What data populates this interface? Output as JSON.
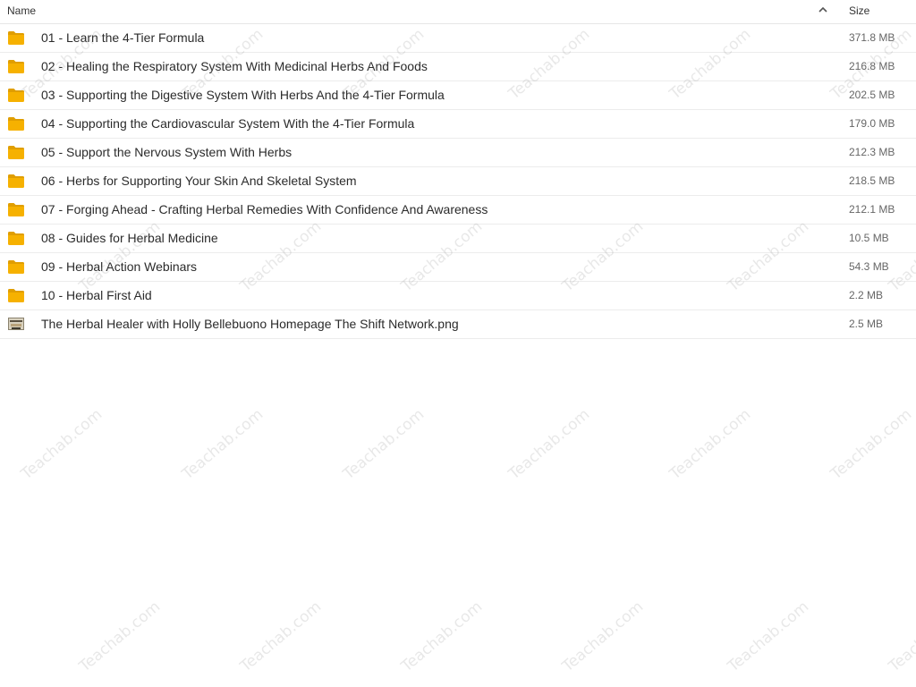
{
  "header": {
    "name_label": "Name",
    "size_label": "Size",
    "sort_icon": "chevron-up-icon"
  },
  "rows": [
    {
      "name": "01 - Learn the 4-Tier Formula",
      "size": "371.8 MB",
      "type": "folder"
    },
    {
      "name": "02 - Healing the Respiratory System With Medicinal Herbs And Foods",
      "size": "216.8 MB",
      "type": "folder"
    },
    {
      "name": "03 - Supporting the Digestive System With Herbs And the 4-Tier Formula",
      "size": "202.5 MB",
      "type": "folder"
    },
    {
      "name": "04 - Supporting the Cardiovascular System With the 4-Tier Formula",
      "size": "179.0 MB",
      "type": "folder"
    },
    {
      "name": "05 - Support the Nervous System With Herbs",
      "size": "212.3 MB",
      "type": "folder"
    },
    {
      "name": "06 - Herbs for Supporting Your Skin And Skeletal System",
      "size": "218.5 MB",
      "type": "folder"
    },
    {
      "name": "07 - Forging Ahead - Crafting Herbal Remedies With Confidence And Awareness",
      "size": "212.1 MB",
      "type": "folder"
    },
    {
      "name": "08 - Guides for Herbal Medicine",
      "size": "10.5 MB",
      "type": "folder"
    },
    {
      "name": "09 - Herbal Action Webinars",
      "size": "54.3 MB",
      "type": "folder"
    },
    {
      "name": "10 - Herbal First Aid",
      "size": "2.2 MB",
      "type": "folder"
    },
    {
      "name": "The Herbal Healer with Holly Bellebuono Homepage The Shift Network.png",
      "size": "2.5 MB",
      "type": "image"
    }
  ],
  "watermark": {
    "text": "Teachab.com"
  },
  "colors": {
    "folder": "#f6b100",
    "folder_tab": "#e09e00",
    "divider": "#ececec"
  }
}
